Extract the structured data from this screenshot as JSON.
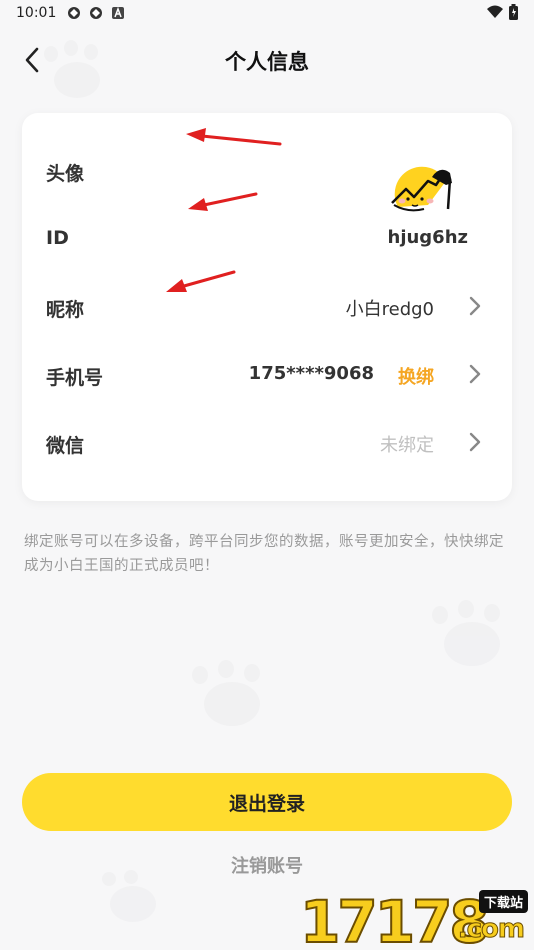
{
  "status_bar": {
    "time": "10:01",
    "icons_left": [
      "app-icon",
      "app-icon",
      "a-icon"
    ],
    "icons_right": [
      "wifi-icon",
      "battery-icon"
    ]
  },
  "header": {
    "title": "个人信息",
    "back_icon": "chevron-left-icon"
  },
  "profile": {
    "avatar_label": "头像",
    "id_label": "ID",
    "id_value": "hjug6hz",
    "nickname_label": "昵称",
    "nickname_value": "小白redg0",
    "phone_label": "手机号",
    "phone_value": "175****9068",
    "phone_action": "换绑",
    "wechat_label": "微信",
    "wechat_value": "未绑定"
  },
  "note": "绑定账号可以在多设备，跨平台同步您的数据，账号更加安全，快快绑定成为小白王国的正式成员吧！",
  "actions": {
    "logout_label": "退出登录",
    "cancel_account_label": "注销账号"
  },
  "watermark": {
    "number": "17178",
    "badge": "下载站",
    "suffix": ".com"
  },
  "colors": {
    "accent": "#ffdc2e",
    "action_text": "#f5a623",
    "arrow": "#e02020",
    "background": "#f7f7f8"
  }
}
